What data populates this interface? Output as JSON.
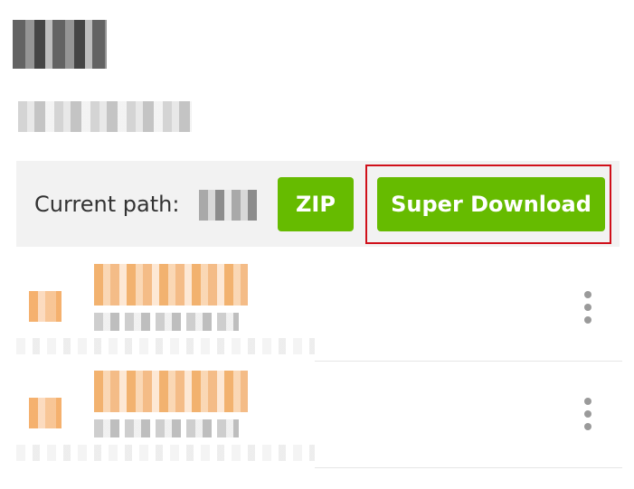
{
  "toolbar": {
    "current_path_label": "Current path:",
    "zip_label": "ZIP",
    "super_download_label": "Super Download"
  },
  "colors": {
    "button_green": "#66bb00",
    "highlight_red": "#d0101a",
    "toolbar_bg": "#f2f2f2"
  },
  "icons": {
    "more": "kebab-vertical-icon"
  }
}
